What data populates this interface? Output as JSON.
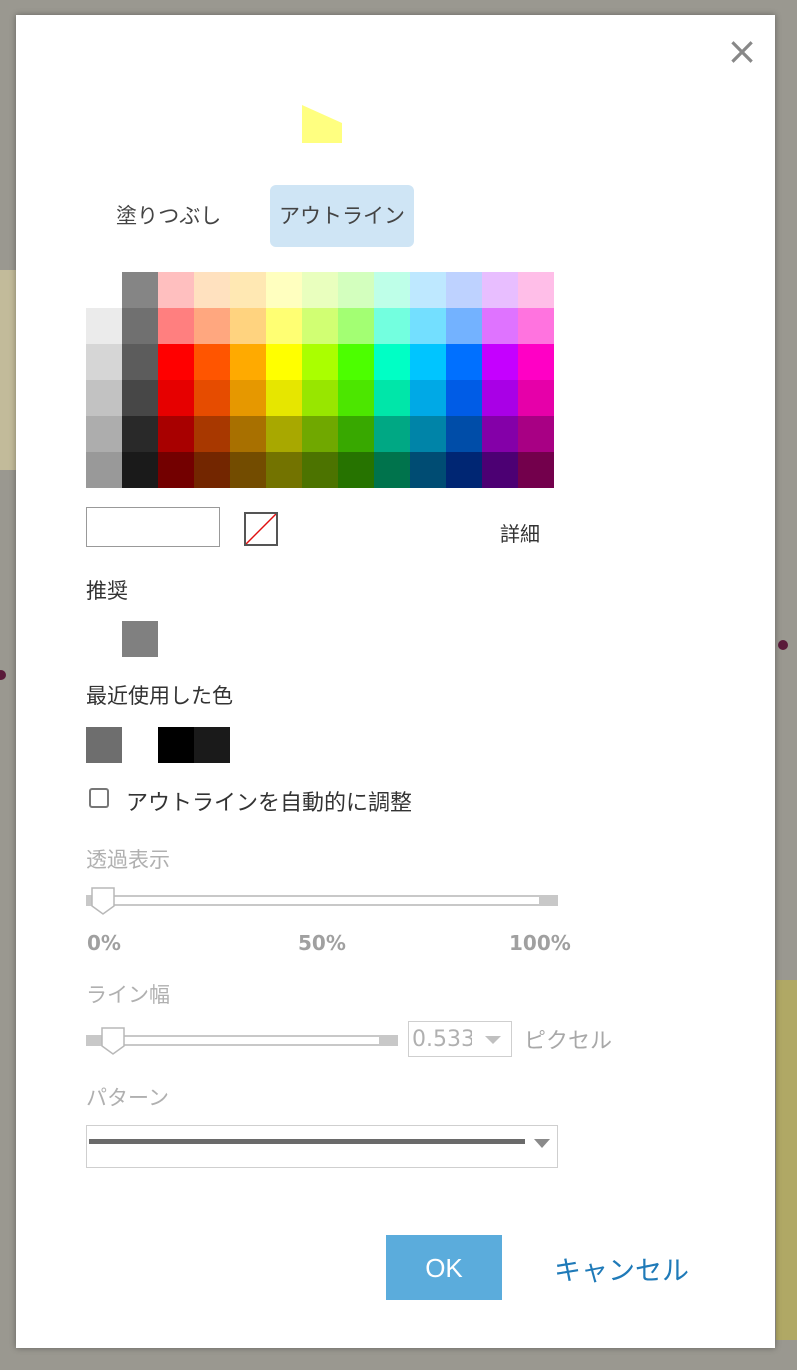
{
  "dialog": {
    "close_label": "×",
    "tabs": [
      {
        "label": "塗りつぶし",
        "selected": false
      },
      {
        "label": "アウトライン",
        "selected": true
      }
    ],
    "preview_color": "#ffff80",
    "palette": {
      "columns": [
        [
          "",
          "#ebebeb",
          "#d6d6d6",
          "#c2c2c2",
          "#adadad",
          "#999999"
        ],
        [
          "#858585",
          "#707070",
          "#5c5c5c",
          "#474747",
          "#292929",
          "#1a1a1a"
        ],
        [
          "#ffbfbf",
          "#ff7f7f",
          "#ff0000",
          "#e60000",
          "#a80000",
          "#730000"
        ],
        [
          "#ffe1bf",
          "#ffa77f",
          "#ff5500",
          "#e64c00",
          "#a83800",
          "#732600"
        ],
        [
          "#ffe8b3",
          "#ffd37f",
          "#ffaa00",
          "#e69800",
          "#a87000",
          "#734c00"
        ],
        [
          "#ffffbf",
          "#ffff73",
          "#ffff00",
          "#e6e600",
          "#a8a800",
          "#737300"
        ],
        [
          "#e9ffbe",
          "#d1ff73",
          "#aaff00",
          "#98e600",
          "#70a800",
          "#4c7300"
        ],
        [
          "#d3ffbe",
          "#a3ff73",
          "#4cff00",
          "#4ce600",
          "#38a800",
          "#267300"
        ],
        [
          "#beffe8",
          "#73ffdf",
          "#00ffc5",
          "#00e6a9",
          "#00a884",
          "#00734c"
        ],
        [
          "#bee8ff",
          "#73dfff",
          "#00c5ff",
          "#00a9e6",
          "#0084a8",
          "#004c73"
        ],
        [
          "#bed2ff",
          "#73b2ff",
          "#0070ff",
          "#005ce6",
          "#004da8",
          "#002673"
        ],
        [
          "#e8beff",
          "#df73ff",
          "#c500ff",
          "#a900e6",
          "#8400a8",
          "#4c0073"
        ],
        [
          "#ffbee8",
          "#ff73df",
          "#ff00c5",
          "#e600a9",
          "#a80084",
          "#73004c"
        ]
      ]
    },
    "hex_value": "",
    "detail_link": "詳細",
    "recommended": {
      "label": "推奨",
      "colors": [
        "#808080"
      ]
    },
    "recent": {
      "label": "最近使用した色",
      "colors": [
        "#6e6e6e",
        "",
        "#000000",
        "#1a1a1a"
      ]
    },
    "auto_adjust": {
      "label": "アウトラインを自動的に調整",
      "checked": false
    },
    "transparency": {
      "label": "透過表示",
      "value_percent": 0,
      "ticks": [
        "0%",
        "50%",
        "100%"
      ]
    },
    "line_width": {
      "label": "ライン幅",
      "value": "0.533",
      "unit": "ピクセル",
      "slider_fraction": 0.08
    },
    "pattern": {
      "label": "パターン",
      "selected": "solid"
    },
    "ok_label": "OK",
    "cancel_label": "キャンセル"
  }
}
